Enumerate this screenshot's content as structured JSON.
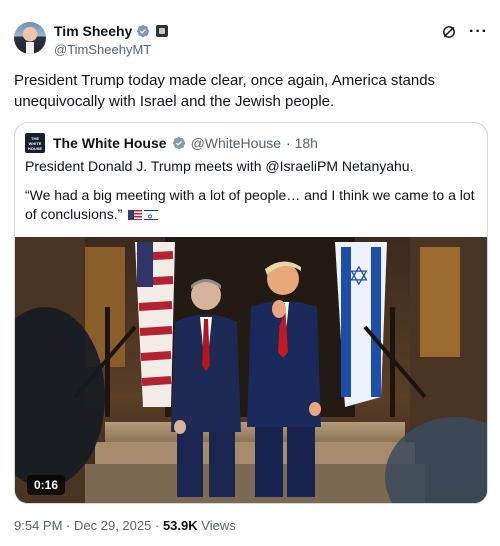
{
  "author": {
    "display_name": "Tim Sheehy",
    "handle": "@TimSheehyMT"
  },
  "tweet": {
    "text": "President Trump today made clear, once again, America stands unequivocally with Israel and the Jewish people."
  },
  "quoted": {
    "display_name": "The White House",
    "handle": "@WhiteHouse",
    "time": "· 18h",
    "text_line1": "President Donald J. Trump meets with @IsraeliPM Netanyahu.",
    "text_line2": "“We had a big meeting with a lot of people… and I think we came to a lot of conclusions.”",
    "logo_text": "THE WHITE HOUSE",
    "video_duration": "0:16"
  },
  "meta": {
    "time": "9:54 PM",
    "date": "Dec 29, 2025",
    "separator": "·",
    "views_count": "53.9K",
    "views_label": "Views"
  },
  "colors": {
    "verified_blue": "#1d9bf0",
    "gray_verified": "#829aab"
  }
}
